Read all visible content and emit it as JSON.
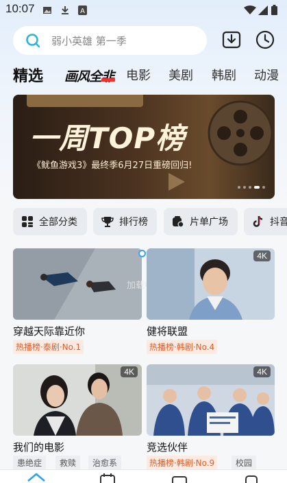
{
  "status_bar": {
    "time": "10:07",
    "icons": [
      "image-icon",
      "download-icon",
      "text-a-icon",
      "wifi-icon",
      "signal-icon",
      "battery-icon"
    ]
  },
  "search": {
    "placeholder": "弱小英雄 第一季"
  },
  "header_buttons": [
    "download-icon",
    "history-clock-icon"
  ],
  "tabs": [
    {
      "label": "精选",
      "active": true
    },
    {
      "label": "画风全非",
      "logo": true
    },
    {
      "label": "电影"
    },
    {
      "label": "美剧"
    },
    {
      "label": "韩剧"
    },
    {
      "label": "动漫"
    }
  ],
  "banner": {
    "title": "一周TOP榜",
    "subtitle": "《鱿鱼游戏3》最终季6月27日重磅回归!",
    "dots": 5,
    "active_dot": 4
  },
  "chips": [
    {
      "label": "全部分类",
      "icon": "grid-icon"
    },
    {
      "label": "排行榜",
      "icon": "trophy-icon"
    },
    {
      "label": "片单广场",
      "icon": "playlist-icon"
    },
    {
      "label": "抖音",
      "icon": "tiktok-icon"
    }
  ],
  "cards": [
    {
      "title": "穿越天际靠近你",
      "tag": "热播榜·泰剧·No.1",
      "badge": ""
    },
    {
      "title": "健将联盟",
      "tag": "热播榜·韩剧·No.4",
      "badge": "4K"
    },
    {
      "title": "我们的电影",
      "tags": [
        "患绝症",
        "救赎",
        "治愈系"
      ],
      "badge": "4K"
    },
    {
      "title": "竞选伙伴",
      "tag": "热播榜·韩剧·No.9",
      "extra_tag": "校园",
      "badge": "4K"
    }
  ],
  "loading_text": "加载中...",
  "colors": {
    "accent": "#3aa0ff",
    "hot_tag_text": "#e35b2b",
    "hot_tag_bg": "#fdebe2"
  }
}
